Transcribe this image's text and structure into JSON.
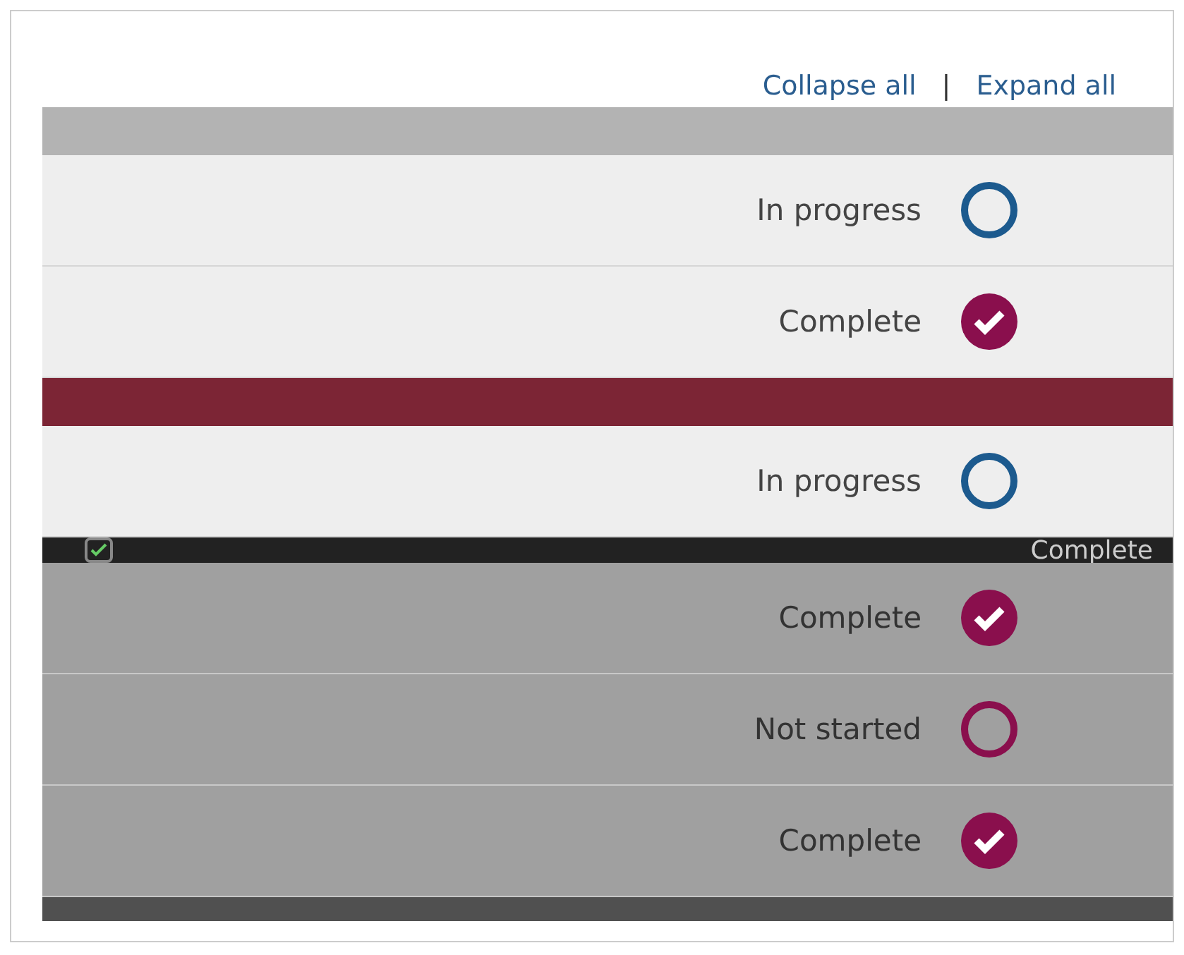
{
  "toolbar": {
    "links": [
      {
        "label": "Collapse all"
      },
      {
        "label": "Expand all"
      }
    ],
    "separator": "|"
  },
  "sections": [
    {
      "color": "#b3b3b3",
      "dimmed": false,
      "items": [
        {
          "status": "In progress",
          "kind": "in_progress"
        },
        {
          "status": "Complete",
          "kind": "complete"
        }
      ]
    },
    {
      "color": "#7c2535",
      "dimmed": false,
      "items": [
        {
          "status": "In progress",
          "kind": "in_progress"
        }
      ]
    },
    {
      "color": "#222222",
      "dimmed": true,
      "header_status": "Complete",
      "header_checked": true,
      "items": [
        {
          "status": "Complete",
          "kind": "complete"
        },
        {
          "status": "Not started",
          "kind": "not_started"
        },
        {
          "status": "Complete",
          "kind": "complete"
        }
      ]
    }
  ]
}
